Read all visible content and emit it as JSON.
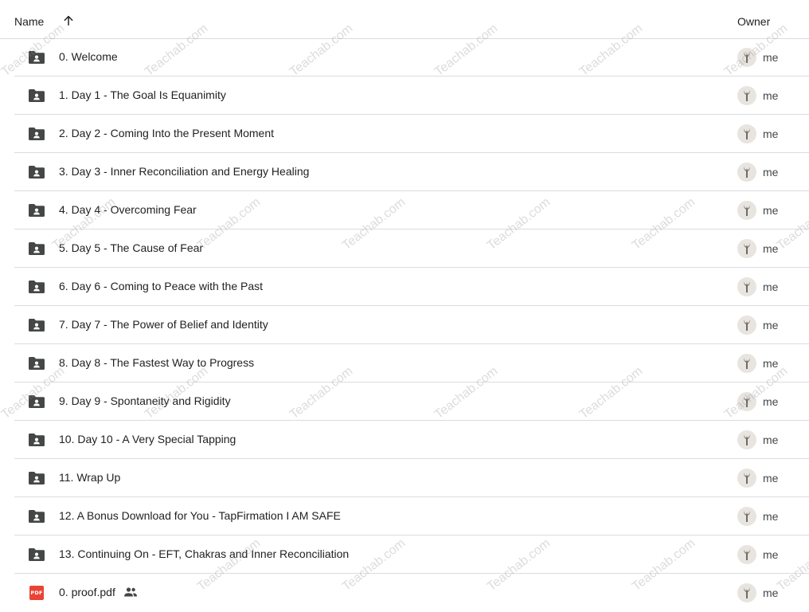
{
  "header": {
    "name_label": "Name",
    "owner_label": "Owner",
    "sort_icon": "arrow-up-icon"
  },
  "files": [
    {
      "name": "0. Welcome",
      "type": "shared-folder",
      "owner": "me"
    },
    {
      "name": "1. Day 1 - The Goal Is Equanimity",
      "type": "shared-folder",
      "owner": "me"
    },
    {
      "name": "2. Day 2 - Coming Into the Present Moment",
      "type": "shared-folder",
      "owner": "me"
    },
    {
      "name": "3. Day 3 - Inner Reconciliation and Energy Healing",
      "type": "shared-folder",
      "owner": "me"
    },
    {
      "name": "4. Day 4 - Overcoming Fear",
      "type": "shared-folder",
      "owner": "me"
    },
    {
      "name": "5. Day 5 - The Cause of Fear",
      "type": "shared-folder",
      "owner": "me"
    },
    {
      "name": "6. Day 6 - Coming to Peace with the Past",
      "type": "shared-folder",
      "owner": "me"
    },
    {
      "name": "7. Day 7 - The Power of Belief and Identity",
      "type": "shared-folder",
      "owner": "me"
    },
    {
      "name": "8. Day 8 - The Fastest Way to Progress",
      "type": "shared-folder",
      "owner": "me"
    },
    {
      "name": "9. Day 9 - Spontaneity and Rigidity",
      "type": "shared-folder",
      "owner": "me"
    },
    {
      "name": "10. Day 10 - A Very Special Tapping",
      "type": "shared-folder",
      "owner": "me"
    },
    {
      "name": "11. Wrap Up",
      "type": "shared-folder",
      "owner": "me"
    },
    {
      "name": "12. A Bonus Download for You - TapFirmation I AM SAFE",
      "type": "shared-folder",
      "owner": "me"
    },
    {
      "name": "13. Continuing On - EFT, Chakras and Inner Reconciliation",
      "type": "shared-folder",
      "owner": "me"
    },
    {
      "name": "0. proof.pdf",
      "type": "pdf",
      "owner": "me",
      "shared": true,
      "badge": "PDF"
    }
  ],
  "watermark": {
    "text": "Teachab.com"
  },
  "colors": {
    "folder_icon": "#444746",
    "pdf_icon": "#ea4335",
    "divider": "#dadce0",
    "avatar_bg": "#e8e4df",
    "watermark": "#969696"
  },
  "icons": {
    "folder": "shared-folder-icon",
    "pdf": "pdf-icon",
    "shared": "people-icon",
    "avatar": "user-avatar"
  }
}
